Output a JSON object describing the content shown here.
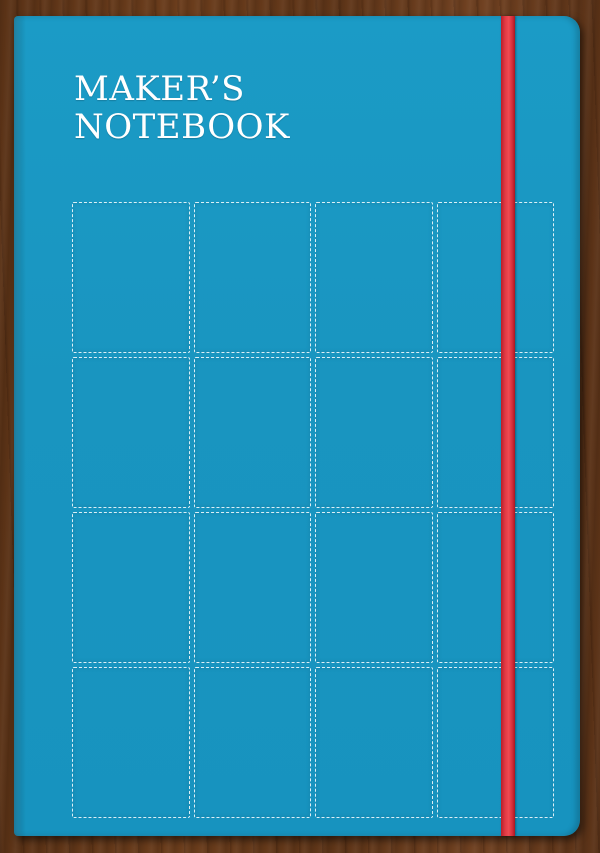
{
  "cover": {
    "title_line1": "MAKER’S",
    "title_line2": "NOTEBOOK"
  },
  "grid": {
    "rows": 4,
    "columns": 4
  },
  "colors": {
    "cover": "#1996c1",
    "band": "#e23a44",
    "stitching": "#ffffff",
    "table": "#5e3518"
  }
}
